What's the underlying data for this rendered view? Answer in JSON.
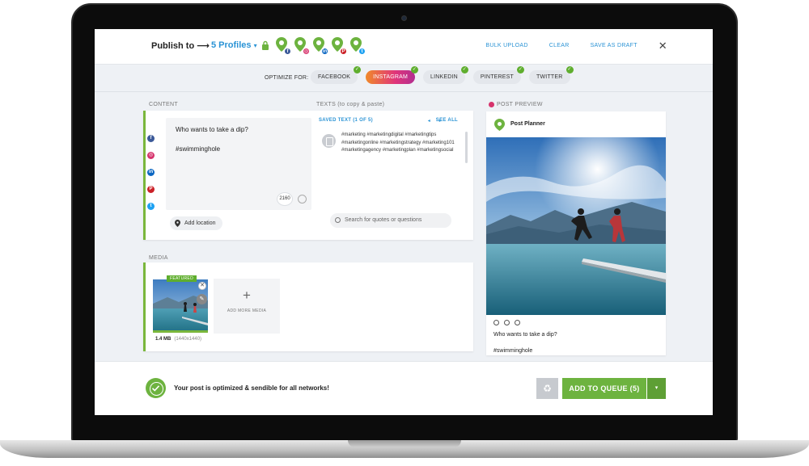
{
  "header": {
    "publish_label": "Publish to ⟶",
    "profiles_label": "5 Profiles",
    "profiles_caret": "▾",
    "profile_networks": [
      {
        "network": "facebook",
        "glyph": "f",
        "color": "#3b5998"
      },
      {
        "network": "instagram",
        "glyph": "◎",
        "color": "#d6336c"
      },
      {
        "network": "linkedin",
        "glyph": "in",
        "color": "#0a66c2"
      },
      {
        "network": "pinterest",
        "glyph": "P",
        "color": "#cb2027"
      },
      {
        "network": "twitter",
        "glyph": "t",
        "color": "#1da1f2"
      }
    ],
    "bulk_upload": "BULK UPLOAD",
    "clear": "CLEAR",
    "save_as_draft": "SAVE AS DRAFT",
    "close_glyph": "✕"
  },
  "optimize": {
    "label": "OPTIMIZE FOR:",
    "tabs": [
      {
        "label": "FACEBOOK",
        "active": false,
        "check": "✓"
      },
      {
        "label": "INSTAGRAM",
        "active": true,
        "check": "✓"
      },
      {
        "label": "LINKEDIN",
        "active": false,
        "check": "✓"
      },
      {
        "label": "PINTEREST",
        "active": false,
        "check": "✓"
      },
      {
        "label": "TWITTER",
        "active": false,
        "check": "✓"
      }
    ]
  },
  "content": {
    "section_label": "CONTENT",
    "post_line1": "Who wants to take a dip?",
    "post_line2": "#swimminghole",
    "char_count": "2160",
    "add_location": "Add location"
  },
  "texts": {
    "section_label": "TEXTS (to copy & paste)",
    "saved_label": "SAVED TEXT (1 OF 5)",
    "prev": "◂",
    "next": "▸",
    "see_all": "SEE ALL",
    "saved_text": "#marketing #marketingdigital #marketingtips #marketingonline #marketingstrategy #marketing101 #marketingagency #marketingplan #marketingsocial",
    "search_placeholder": "Search for quotes or questions"
  },
  "media": {
    "section_label": "MEDIA",
    "featured": "FEATURED",
    "remove_glyph": "✕",
    "edit_glyph": "✎",
    "size": "1.4 MB",
    "dimensions": "(1440x1440)",
    "add_more_plus": "+",
    "add_more": "ADD MORE MEDIA"
  },
  "preview": {
    "section_label": "POST PREVIEW",
    "account": "Post Planner",
    "caption_line1": "Who wants to take a dip?",
    "caption_line2": "#swimminghole"
  },
  "footer": {
    "status": "Your post is optimized & sendible for all networks!",
    "recycle_glyph": "♻",
    "queue_label": "ADD TO QUEUE (5)",
    "dropdown_glyph": "▾"
  },
  "colors": {
    "accent_blue": "#2a93d5",
    "accent_green": "#6db33f",
    "instagram_gradient": [
      "#f08a2a",
      "#e0357a",
      "#b22e90"
    ]
  }
}
